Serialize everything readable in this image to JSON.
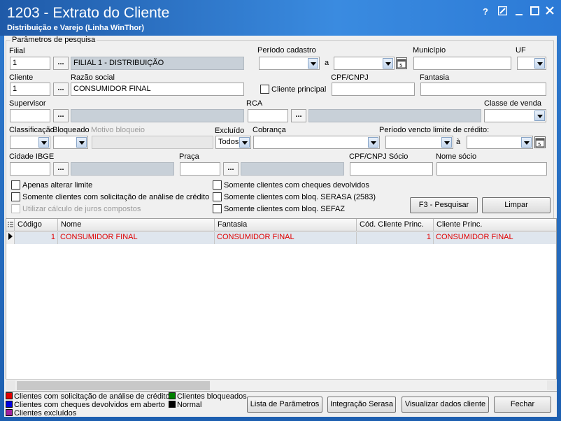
{
  "window": {
    "title": "1203 - Extrato do Cliente",
    "subtitle": "Distribuição e Varejo (Linha WinThor)",
    "help_glyph": "?",
    "colors": {
      "title_bg": "#2c7ad6",
      "legend_red": "#e00000",
      "legend_blue": "#0000e0",
      "legend_purple": "#a020a0",
      "legend_green": "#008000",
      "legend_black": "#000000"
    }
  },
  "params": {
    "legend": "Parâmetros de pesquisa",
    "filial": {
      "label": "Filial",
      "code": "1",
      "name": "FILIAL 1 - DISTRIBUIÇÃO"
    },
    "periodo_cadastro": {
      "label": "Período cadastro",
      "sep": "a"
    },
    "municipio": {
      "label": "Município"
    },
    "uf": {
      "label": "UF"
    },
    "cliente": {
      "label": "Cliente",
      "code": "1"
    },
    "razao_social": {
      "label": "Razão social",
      "value": "CONSUMIDOR FINAL"
    },
    "cliente_principal": {
      "label": "Cliente principal"
    },
    "cpf_cnpj": {
      "label": "CPF/CNPJ"
    },
    "fantasia": {
      "label": "Fantasia"
    },
    "supervisor": {
      "label": "Supervisor"
    },
    "rca": {
      "label": "RCA"
    },
    "classe_venda": {
      "label": "Classe de venda"
    },
    "classificacao": {
      "label": "Classificação"
    },
    "bloqueado": {
      "label": "Bloqueado"
    },
    "motivo_bloqueio": {
      "label": "Motivo bloqueio"
    },
    "excluido": {
      "label": "Excluído",
      "value": "Todos"
    },
    "cobranca": {
      "label": "Cobrança"
    },
    "periodo_vencto": {
      "label": "Período vencto limite de crédito:",
      "sep": "à"
    },
    "cidade_ibge": {
      "label": "Cidade IBGE"
    },
    "praca": {
      "label": "Praça"
    },
    "cpf_cnpj_socio": {
      "label": "CPF/CNPJ Sócio"
    },
    "nome_socio": {
      "label": "Nome sócio"
    },
    "ellipsis": "..."
  },
  "checks": {
    "apenas_alterar": "Apenas alterar limite",
    "analise_credito": "Somente clientes com solicitação de análise de crédito",
    "juros_compostos": "Utilizar cálculo de juros compostos",
    "cheques_devolvidos": "Somente clientes com cheques devolvidos",
    "bloq_serasa": "Somente clientes com bloq. SERASA (2583)",
    "bloq_sefaz": "Somente clientes com bloq. SEFAZ"
  },
  "buttons": {
    "pesquisar": "F3 - Pesquisar",
    "limpar": "Limpar",
    "lista_parametros": "Lista de Parâmetros",
    "integracao_serasa": "Integração Serasa",
    "visualizar": "Visualizar dados cliente",
    "fechar": "Fechar"
  },
  "grid": {
    "columns": [
      "Código",
      "Nome",
      "Fantasia",
      "Cód. Cliente Princ.",
      "Cliente Princ."
    ],
    "rows": [
      {
        "codigo": "1",
        "nome": "CONSUMIDOR FINAL",
        "fantasia": "CONSUMIDOR FINAL",
        "cod_princ": "1",
        "cliente_princ": "CONSUMIDOR FINAL"
      }
    ]
  },
  "legend": {
    "analise": "Clientes com solicitação de análise de crédito",
    "cheques": "Clientes com cheques devolvidos em aberto",
    "excluidos": "Clientes excluídos",
    "bloqueados": "Clientes bloqueados",
    "normal": "Normal"
  }
}
